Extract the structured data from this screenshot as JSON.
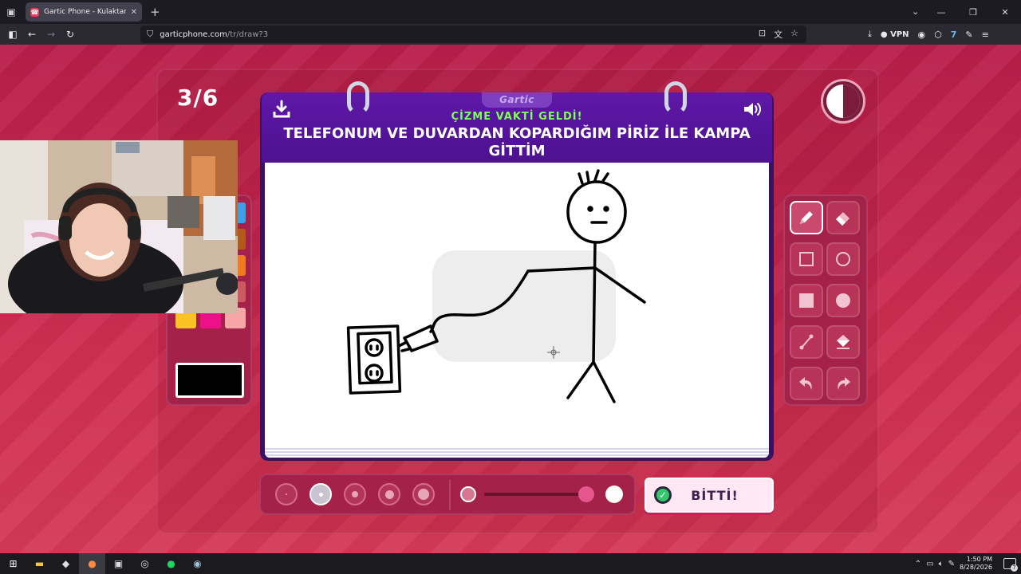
{
  "browser": {
    "tab_title": "Gartic Phone - Kulaktan Kulağa",
    "url_domain": "garticphone.com",
    "url_path": "/tr/draw?3",
    "vpn_label": "VPN"
  },
  "game": {
    "round": "3/6",
    "gartic_label": "Gartic",
    "header_subtitle": "ÇİZME VAKTİ GELDİ!",
    "prompt": "TELEFONUM VE DUVARDAN KOPARDIĞIM PİRİZ İLE KAMPA GİTTİM",
    "done_button": "BİTTİ!",
    "timer_remaining_fraction": 0.5
  },
  "palette": {
    "colors": [
      "#2f7be6",
      "#ffffff",
      "#3e9fe6",
      "#1fa34a",
      "#b70f1a",
      "#b05b1c",
      "#22c53f",
      "#ee1a1a",
      "#f07a22",
      "#b87a20",
      "#990045",
      "#cc5a62",
      "#f9c423",
      "#ec1186",
      "#f7a6a8"
    ],
    "selected_color": "#000000"
  },
  "tools": [
    {
      "name": "pencil",
      "active": true
    },
    {
      "name": "eraser",
      "active": false
    },
    {
      "name": "rectangle-outline",
      "active": false
    },
    {
      "name": "ellipse-outline",
      "active": false
    },
    {
      "name": "rectangle-filled",
      "active": false
    },
    {
      "name": "ellipse-filled",
      "active": false
    },
    {
      "name": "line",
      "active": false
    },
    {
      "name": "fill-bucket",
      "active": false
    },
    {
      "name": "undo",
      "active": false
    },
    {
      "name": "redo",
      "active": false
    }
  ],
  "brush": {
    "sizes_count": 5,
    "selected_size_index": 1,
    "opacity_level": 0.85
  },
  "taskbar": {
    "time": "1:50 PM",
    "date": "8/28/2026",
    "notification_count": "7"
  }
}
